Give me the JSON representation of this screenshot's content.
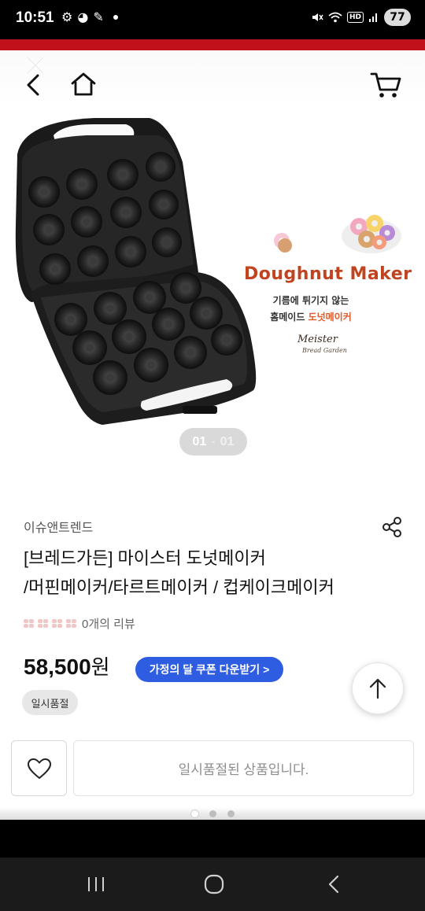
{
  "status_bar": {
    "time": "10:51",
    "hd_label": "HD",
    "battery": "77"
  },
  "header": {
    "icons": [
      "close-icon",
      "back-icon",
      "home-icon",
      "cart-icon"
    ]
  },
  "product_image": {
    "brand_mark": "Meister",
    "brand_sub": "Bread Garden",
    "promo_title": "Doughnut Maker",
    "promo_line1": "기름에 튀기지 않는",
    "promo_line2_prefix": "홈메이드 ",
    "promo_line2_highlight": "도넛메이커"
  },
  "image_pager": {
    "current": "01",
    "separator": "-",
    "total": "01"
  },
  "product": {
    "seller": "이슈앤트렌드",
    "title_line1": "[브레드가든] 마이스터 도넛메이커",
    "title_line2": "/머핀메이커/타르트메이커 / 컵케이크메이커",
    "review_count_text": "0개의 리뷰",
    "price": "58,500",
    "price_unit": "원",
    "coupon_label": "가정의 달 쿠폰 다운받기 >",
    "status_badge": "일시품절"
  },
  "action_bar": {
    "soldout_message": "일시품절된 상품입니다."
  },
  "colors": {
    "brand_red": "#c1121c",
    "coupon_blue": "#2f5de2",
    "promo_orange": "#c1431f"
  }
}
